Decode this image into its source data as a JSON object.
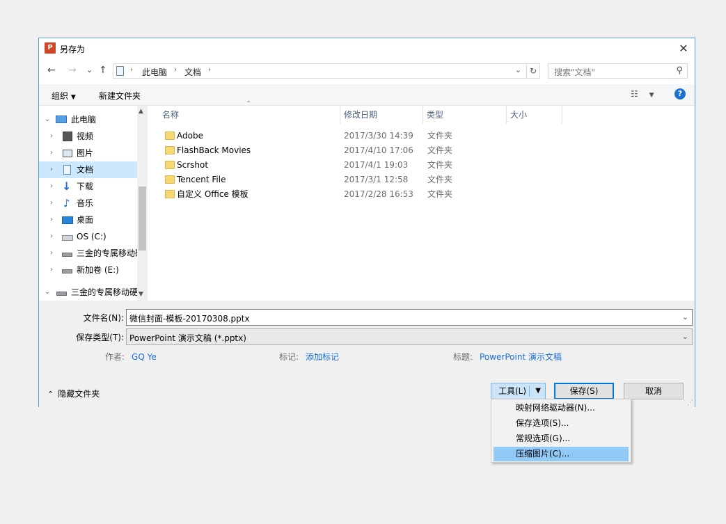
{
  "window": {
    "title": "另存为",
    "app_icon": "powerpoint-icon"
  },
  "nav": {
    "back": "←",
    "forward": "→",
    "recent": "⌄",
    "up": "↑",
    "address": [
      "此电脑",
      "文档"
    ],
    "search_placeholder": "搜索\"文档\""
  },
  "toolbar": {
    "organize": "组织",
    "new_folder": "新建文件夹",
    "help": "?"
  },
  "sidebar": {
    "items": [
      {
        "label": "此电脑",
        "icon": "computer-icon",
        "expanded": true
      },
      {
        "label": "视频",
        "icon": "video-icon"
      },
      {
        "label": "图片",
        "icon": "pictures-icon"
      },
      {
        "label": "文档",
        "icon": "documents-icon",
        "selected": true
      },
      {
        "label": "下载",
        "icon": "download-icon"
      },
      {
        "label": "音乐",
        "icon": "music-icon"
      },
      {
        "label": "桌面",
        "icon": "desktop-icon"
      },
      {
        "label": "OS (C:)",
        "icon": "os-drive-icon"
      },
      {
        "label": "三金的专属移动硬",
        "icon": "drive-icon"
      },
      {
        "label": "新加卷 (E:)",
        "icon": "drive-icon"
      },
      {
        "label": "三金的专属移动硬",
        "icon": "drive-icon",
        "expanded": true
      }
    ]
  },
  "columns": {
    "name": "名称",
    "modified": "修改日期",
    "type": "类型",
    "size": "大小"
  },
  "files": [
    {
      "name": "Adobe",
      "modified": "2017/3/30 14:39",
      "type": "文件夹"
    },
    {
      "name": "FlashBack Movies",
      "modified": "2017/4/10 17:06",
      "type": "文件夹"
    },
    {
      "name": "Scrshot",
      "modified": "2017/4/1 19:03",
      "type": "文件夹"
    },
    {
      "name": "Tencent File",
      "modified": "2017/3/1 12:58",
      "type": "文件夹"
    },
    {
      "name": "自定义 Office 模板",
      "modified": "2017/2/28 16:53",
      "type": "文件夹"
    }
  ],
  "form": {
    "filename_label": "文件名(N):",
    "filename_value": "微信封面-模板-20170308.pptx",
    "type_label": "保存类型(T):",
    "type_value": "PowerPoint 演示文稿 (*.pptx)",
    "author_label": "作者:",
    "author_value": "GQ Ye",
    "tags_label": "标记:",
    "tags_value": "添加标记",
    "title_label": "标题:",
    "title_value": "PowerPoint 演示文稿"
  },
  "footer": {
    "hide_folders": "隐藏文件夹",
    "tools": "工具(L)",
    "save": "保存(S)",
    "cancel": "取消"
  },
  "tools_menu": [
    {
      "label": "映射网络驱动器(N)..."
    },
    {
      "label": "保存选项(S)..."
    },
    {
      "label": "常规选项(G)..."
    },
    {
      "label": "压缩图片(C)...",
      "highlighted": true
    }
  ]
}
